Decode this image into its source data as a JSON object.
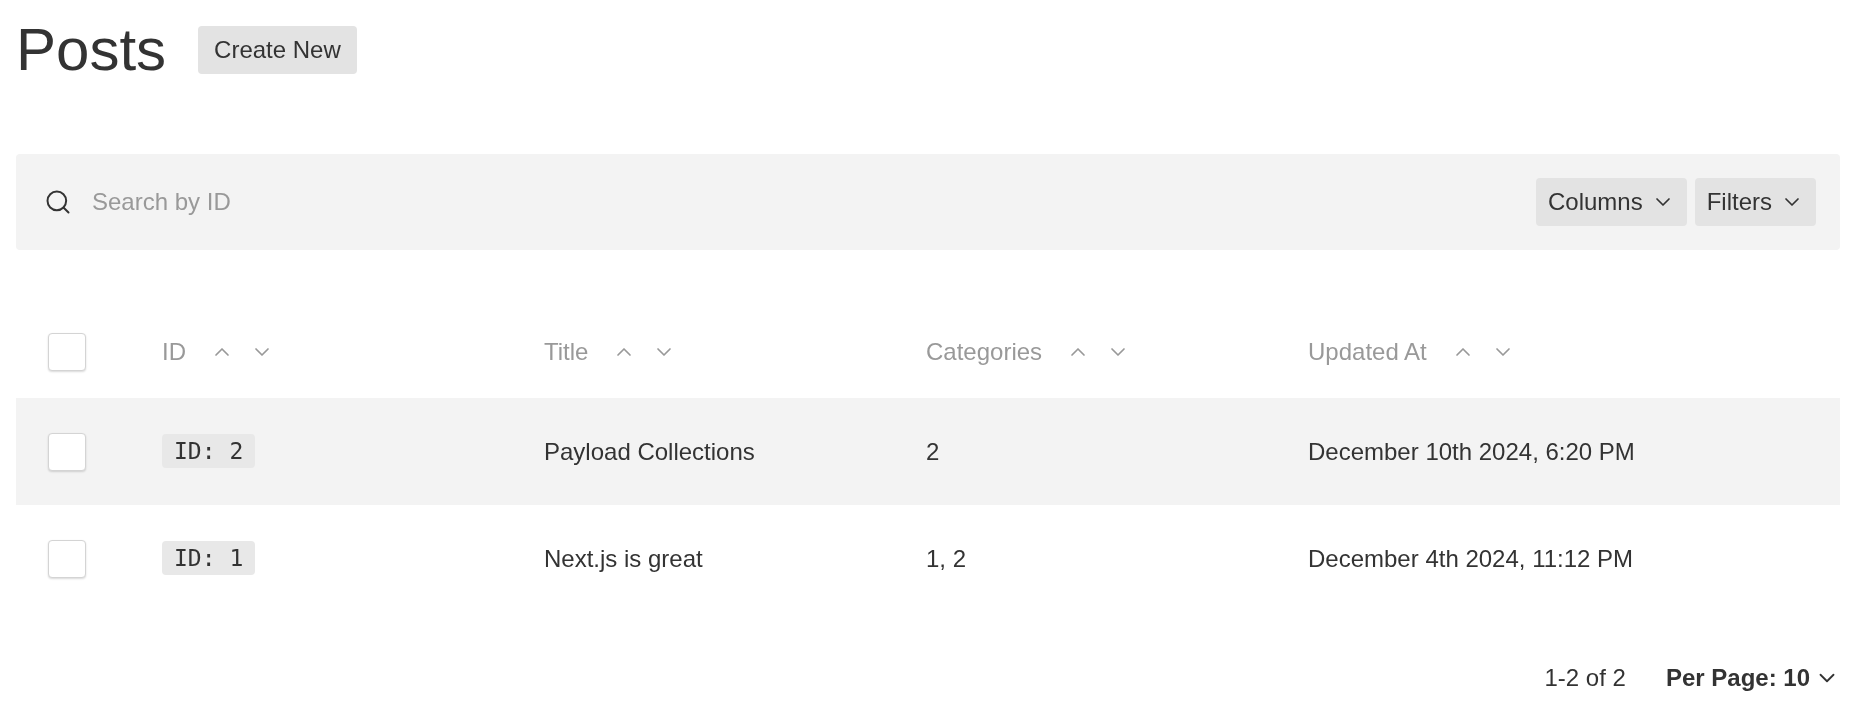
{
  "title": "Posts",
  "create_button": "Create New",
  "search": {
    "placeholder": "Search by ID"
  },
  "toolbar_buttons": [
    "Columns",
    "Filters"
  ],
  "table": {
    "select_all": {
      "checked": false
    },
    "columns": [
      "ID",
      "Title",
      "Categories",
      "Updated At"
    ],
    "rows": [
      {
        "selected": false,
        "id": "ID: 2",
        "title": "Payload Collections",
        "categories": "2",
        "updated_at": "December 10th 2024, 6:20 PM"
      },
      {
        "selected": false,
        "id": "ID: 1",
        "title": "Next.js is great",
        "categories": "1, 2",
        "updated_at": "December 4th 2024, 11:12 PM"
      }
    ]
  },
  "pagination": {
    "range": "1-2 of 2",
    "per_page": "Per Page: 10"
  }
}
